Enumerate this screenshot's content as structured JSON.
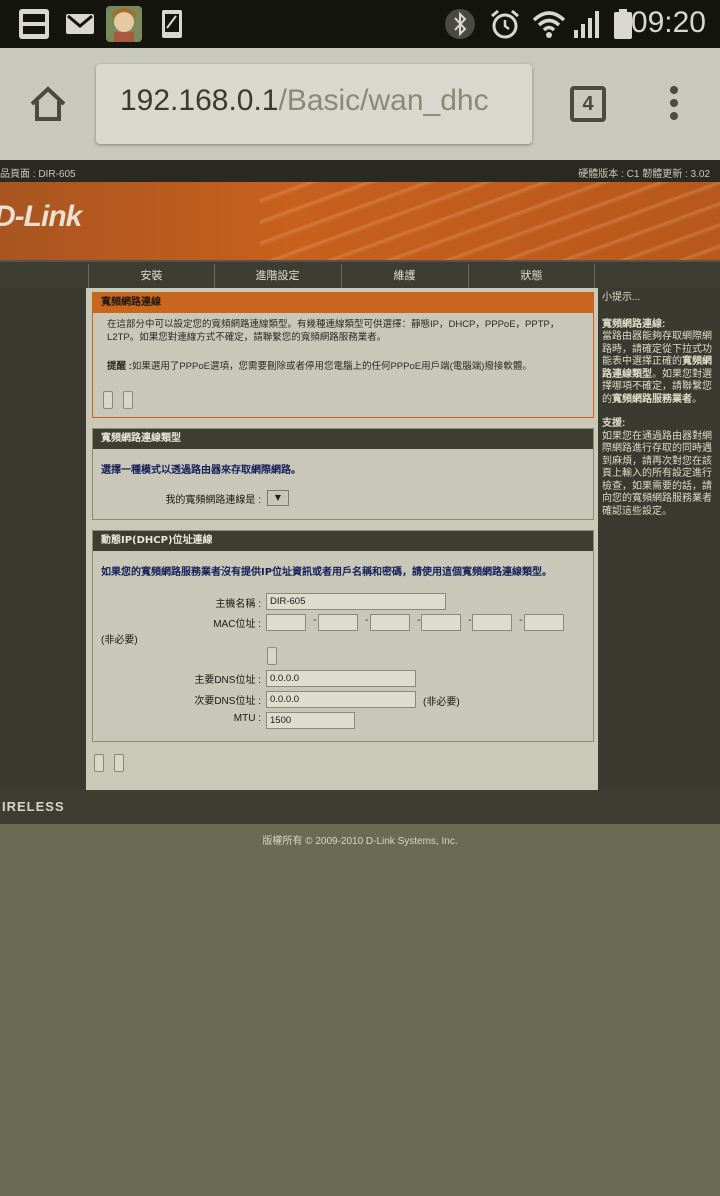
{
  "status_bar": {
    "time": "09:20",
    "left_icons": [
      "momo-app-icon",
      "gmail-icon",
      "avatar-app-icon",
      "screenshot-icon"
    ],
    "right_icons": [
      "bluetooth-icon",
      "alarm-icon",
      "wifi-icon",
      "signal-icon",
      "battery-icon"
    ]
  },
  "browser": {
    "url_host": "192.168.0.1",
    "url_path": "/Basic/wan_dhc",
    "tab_count": "4"
  },
  "router": {
    "top_left": "品頁面 : DIR-605",
    "top_right": "硬體版本 : C1    韌體更新 : 3.02",
    "logo": "D-Link",
    "nav": [
      "安裝",
      "進階設定",
      "維護",
      "狀態"
    ],
    "intro": {
      "title": "寬頻網路連線",
      "body": "在這部分中可以設定您的寬頻網路連線類型。有幾種連線類型可供選擇：靜態IP，DHCP，PPPoE，PPTP，L2TP。如果您對連線方式不確定，請聯繫您的寬頻網路服務業者。",
      "note_label": "提醒 :",
      "note_body": "如果選用了PPPoE選項，您需要刪除或者停用您電腦上的任何PPPoE用戶端(電腦端)撥接軟體。"
    },
    "conn_type": {
      "title": "寬頻網路連線類型",
      "desc": "選擇一種模式以透過路由器來存取網際網路。",
      "label": "我的寬頻網路連線是 :",
      "select_arrow": "▼"
    },
    "dhcp": {
      "title": "動態IP(DHCP)位址連線",
      "desc": "如果您的寬頻網路服務業者沒有提供IP位址資訊或者用戶名稱和密碼，請使用這個寬頻網路連線類型。",
      "host_label": "主機名稱 :",
      "host_value": "DIR-605",
      "mac_label": "MAC位址 :",
      "optional_left": "(非必要)",
      "dns1_label": "主要DNS位址 :",
      "dns1_value": "0.0.0.0",
      "dns2_label": "次要DNS位址 :",
      "dns2_value": "0.0.0.0",
      "dns2_optional": "(非必要)",
      "mtu_label": "MTU :",
      "mtu_value": "1500"
    },
    "tips": {
      "heading": "小提示...",
      "t1_title": "寬頻網路連線:",
      "t1_a": "當路由器能夠存取網際網路時，請確定從下拉式功能表中選擇正確的",
      "t1_b": "寬頻網路連線類型",
      "t1_c": "。如果您對選擇哪項不確定，請聯繫您的",
      "t1_d": "寬頻網路服務業者",
      "t1_e": "。",
      "t2_title": "支援:",
      "t2_body": "如果您在通過路由器對網際網路進行存取的同時遇到麻煩，請再次對您在該頁上輸入的所有設定進行檢查，如果需要的話，請向您的寬頻網路服務業者確認這些設定。"
    },
    "wireless": "IRELESS",
    "copyright": "版權所有 © 2009-2010 D-Link Systems, Inc."
  }
}
